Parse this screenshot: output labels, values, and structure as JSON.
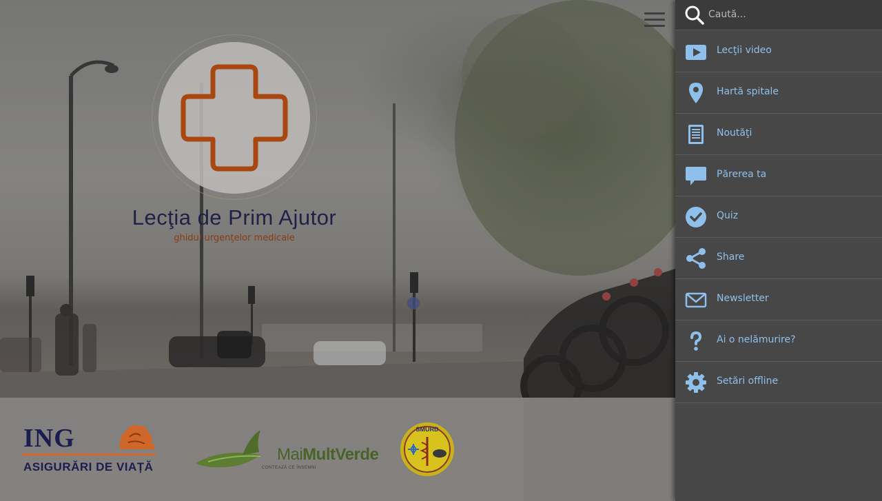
{
  "hero": {
    "title": "Lecţia de Prim Ajutor",
    "subtitle": "ghidul urgenţelor medicale"
  },
  "sponsors": {
    "ing": {
      "name": "ING",
      "tagline": "ASIGURĂRI DE VIAȚĂ"
    },
    "mai_mult_verde": {
      "name_prefix": "Mai",
      "name_bold": "MultVerde",
      "tagline": "CONTEAZĂ CE ÎNSEMNI"
    },
    "smurd": {
      "name": "SMURD"
    }
  },
  "drawer": {
    "search": {
      "placeholder": "Caută..."
    },
    "items": [
      {
        "label": "Lecţii video",
        "icon": "video-play-icon"
      },
      {
        "label": "Hartă spitale",
        "icon": "map-pin-icon"
      },
      {
        "label": "Noutăţi",
        "icon": "news-icon"
      },
      {
        "label": "Părerea ta",
        "icon": "speech-bubble-icon"
      },
      {
        "label": "Quiz",
        "icon": "check-circle-icon"
      },
      {
        "label": "Share",
        "icon": "share-icon"
      },
      {
        "label": "Newsletter",
        "icon": "envelope-icon"
      },
      {
        "label": "Ai o nelămurire?",
        "icon": "question-mark-icon"
      },
      {
        "label": "Setări offline",
        "icon": "gear-icon"
      }
    ]
  },
  "colors": {
    "menu_accent": "#8fc0ec",
    "drawer_bg": "#474747",
    "title_color": "#1f2146",
    "subtitle_color": "#8a3b15",
    "logo_cross": "#a8470f"
  }
}
